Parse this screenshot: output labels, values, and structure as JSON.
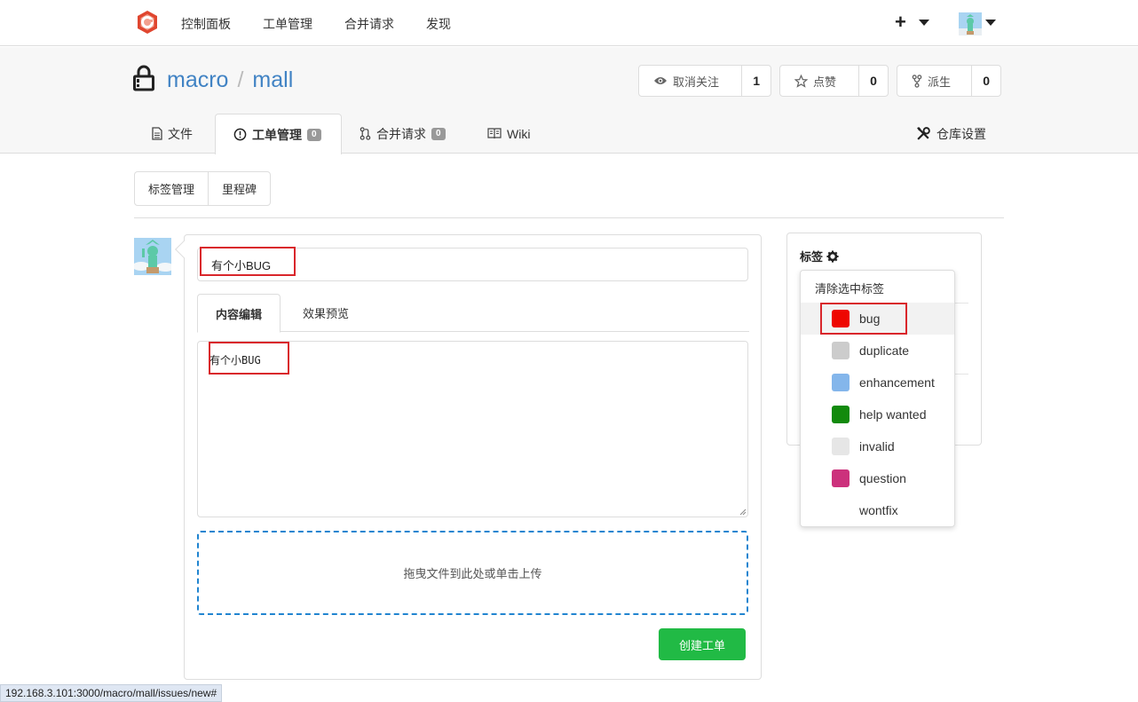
{
  "topnav": {
    "items": [
      "控制面板",
      "工单管理",
      "合并请求",
      "发现"
    ],
    "plus": "+"
  },
  "repo": {
    "owner": "macro",
    "separator": "/",
    "name": "mall",
    "watch_label": "取消关注",
    "watch_count": "1",
    "star_label": "点赞",
    "star_count": "0",
    "fork_label": "派生",
    "fork_count": "0"
  },
  "tabs": {
    "files": "文件",
    "issues": "工单管理",
    "issues_count": "0",
    "pulls": "合并请求",
    "pulls_count": "0",
    "wiki": "Wiki",
    "settings": "仓库设置"
  },
  "subnav": {
    "labels": "标签管理",
    "milestones": "里程碑"
  },
  "form": {
    "title_value": "有个小BUG",
    "tab_edit": "内容编辑",
    "tab_preview": "效果预览",
    "content_value": "有个小BUG",
    "dropzone": "拖曳文件到此处或单击上传",
    "submit": "创建工单"
  },
  "sidebar": {
    "label_header": "标签",
    "clear": "清除选中标签",
    "labels": [
      {
        "name": "bug",
        "color": "#ee0701"
      },
      {
        "name": "duplicate",
        "color": "#cccccc"
      },
      {
        "name": "enhancement",
        "color": "#84b6eb"
      },
      {
        "name": "help wanted",
        "color": "#128a0c"
      },
      {
        "name": "invalid",
        "color": "#e6e6e6"
      },
      {
        "name": "question",
        "color": "#cc317c"
      },
      {
        "name": "wontfix",
        "color": "#ffffff"
      }
    ]
  },
  "status_url": "192.168.3.101:3000/macro/mall/issues/new#"
}
